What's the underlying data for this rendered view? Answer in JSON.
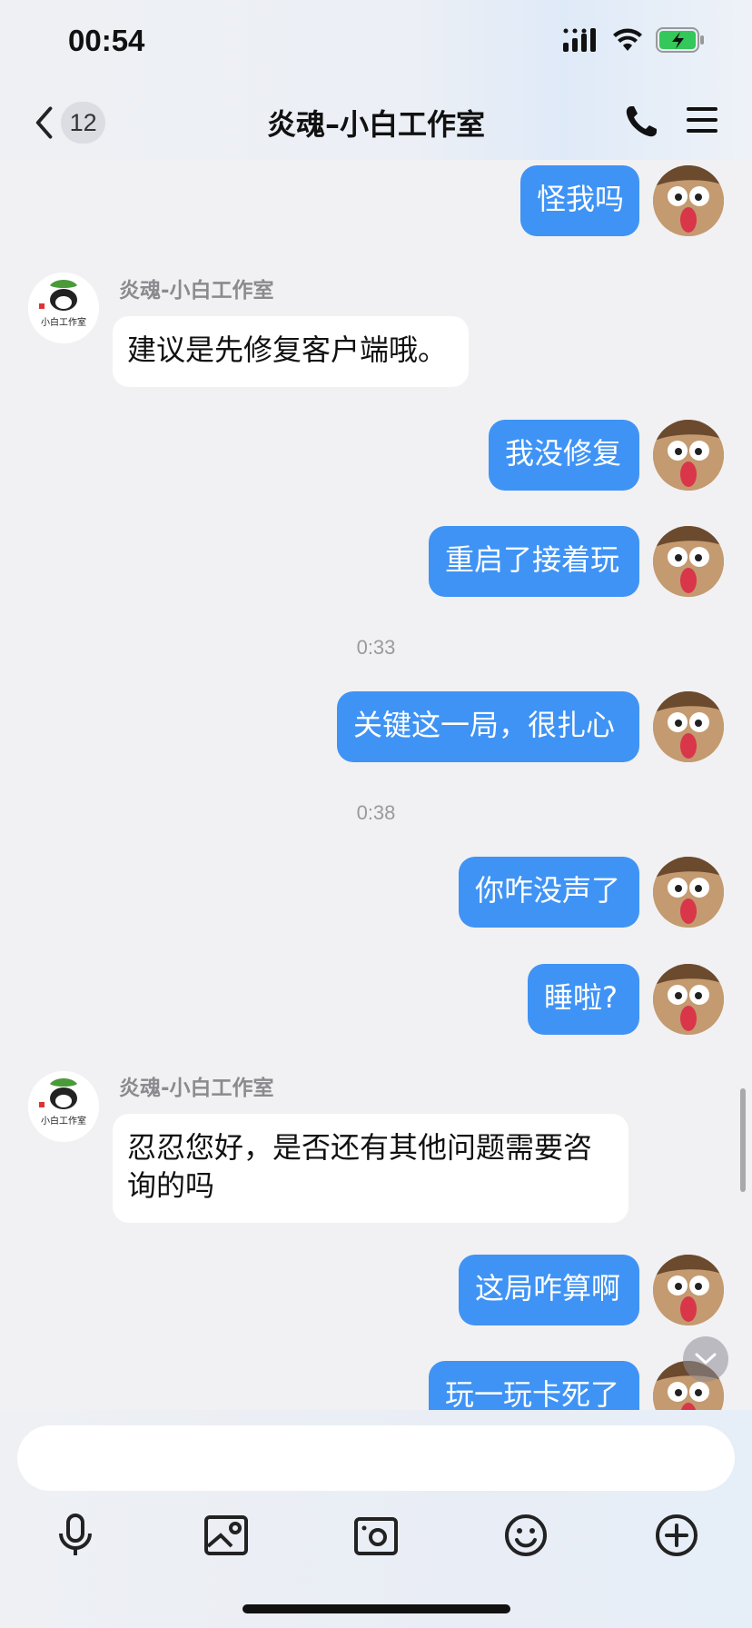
{
  "status_bar": {
    "time": "00:54"
  },
  "header": {
    "back_count": "12",
    "title": "炎魂–小白工作室"
  },
  "contact": {
    "sender_name": "炎魂-小白工作室"
  },
  "messages": [
    {
      "from": "me",
      "text": "怪我吗"
    },
    {
      "from": "them",
      "sender": "炎魂-小白工作室",
      "text": "建议是先修复客户端哦。"
    },
    {
      "from": "me",
      "text": "我没修复"
    },
    {
      "from": "me",
      "text": "重启了接着玩"
    },
    {
      "timestamp": "0:33"
    },
    {
      "from": "me",
      "text": "关键这一局，很扎心"
    },
    {
      "timestamp": "0:38"
    },
    {
      "from": "me",
      "text": "你咋没声了"
    },
    {
      "from": "me",
      "text": "睡啦?"
    },
    {
      "from": "them",
      "sender": "炎魂-小白工作室",
      "text": "忍忍您好，是否还有其他问题需要咨询的吗"
    },
    {
      "from": "me",
      "text": "这局咋算啊"
    },
    {
      "from": "me",
      "text": "玩一玩卡死了"
    }
  ],
  "toolbar": {
    "icons": [
      "microphone-icon",
      "image-icon",
      "camera-icon",
      "emoji-icon",
      "plus-icon"
    ]
  },
  "colors": {
    "bubble_out": "#3f93f5",
    "bubble_in": "#ffffff",
    "background": "#f1f1f3"
  }
}
